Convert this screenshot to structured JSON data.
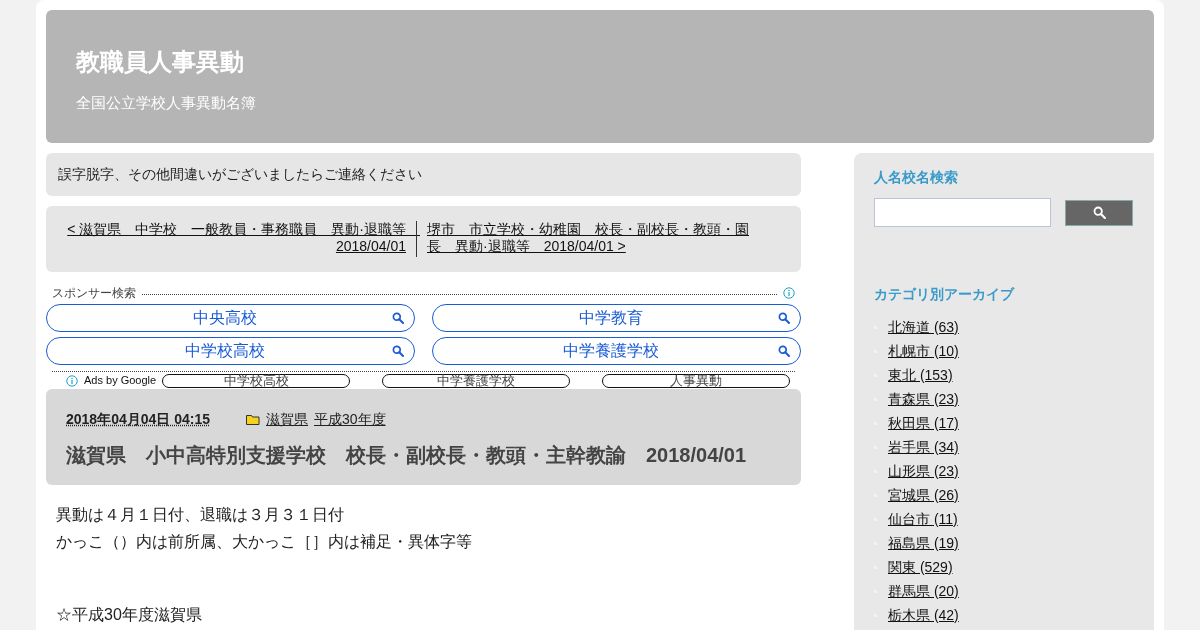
{
  "header": {
    "title": "教職員人事異動",
    "subtitle": "全国公立学校人事異動名簿"
  },
  "notice": "誤字脱字、その他間違いがございましたらご連絡ください",
  "post_nav": {
    "prev": "< 滋賀県　中学校　一般教員・事務職員　異動·退職等　2018/04/01",
    "next": "堺市　市立学校・幼稚園　校長・副校長・教頭・園長　異動·退職等　2018/04/01 >"
  },
  "ads": {
    "label": "スポンサー検索",
    "buttons": [
      "中央高校",
      "中学教育",
      "中学校高校",
      "中学養護学校"
    ],
    "footer_label": "Ads by Google",
    "footer_links": [
      "中学校高校",
      "中学養護学校",
      "人事異動"
    ]
  },
  "article": {
    "date": "2018年04月04日 04:15",
    "categories": [
      "滋賀県",
      "平成30年度"
    ],
    "title": "滋賀県　小中高特別支援学校　校長・副校長・教頭・主幹教諭　2018/04/01",
    "body": [
      "異動は４月１日付、退職は３月３１日付",
      "かっこ（）内は前所属、大かっこ［］内は補足・異体字等"
    ],
    "section_heading": "☆平成30年度滋賀県"
  },
  "sidebar": {
    "search_title": "人名校名検索",
    "archive_title": "カテゴリ別アーカイブ",
    "categories": [
      "北海道 (63)",
      "札幌市 (10)",
      "東北 (153)",
      "青森県 (23)",
      "秋田県 (17)",
      "岩手県 (34)",
      "山形県 (23)",
      "宮城県 (26)",
      "仙台市 (11)",
      "福島県 (19)",
      "関東 (529)",
      "群馬県 (20)",
      "栃木県 (42)"
    ]
  }
}
